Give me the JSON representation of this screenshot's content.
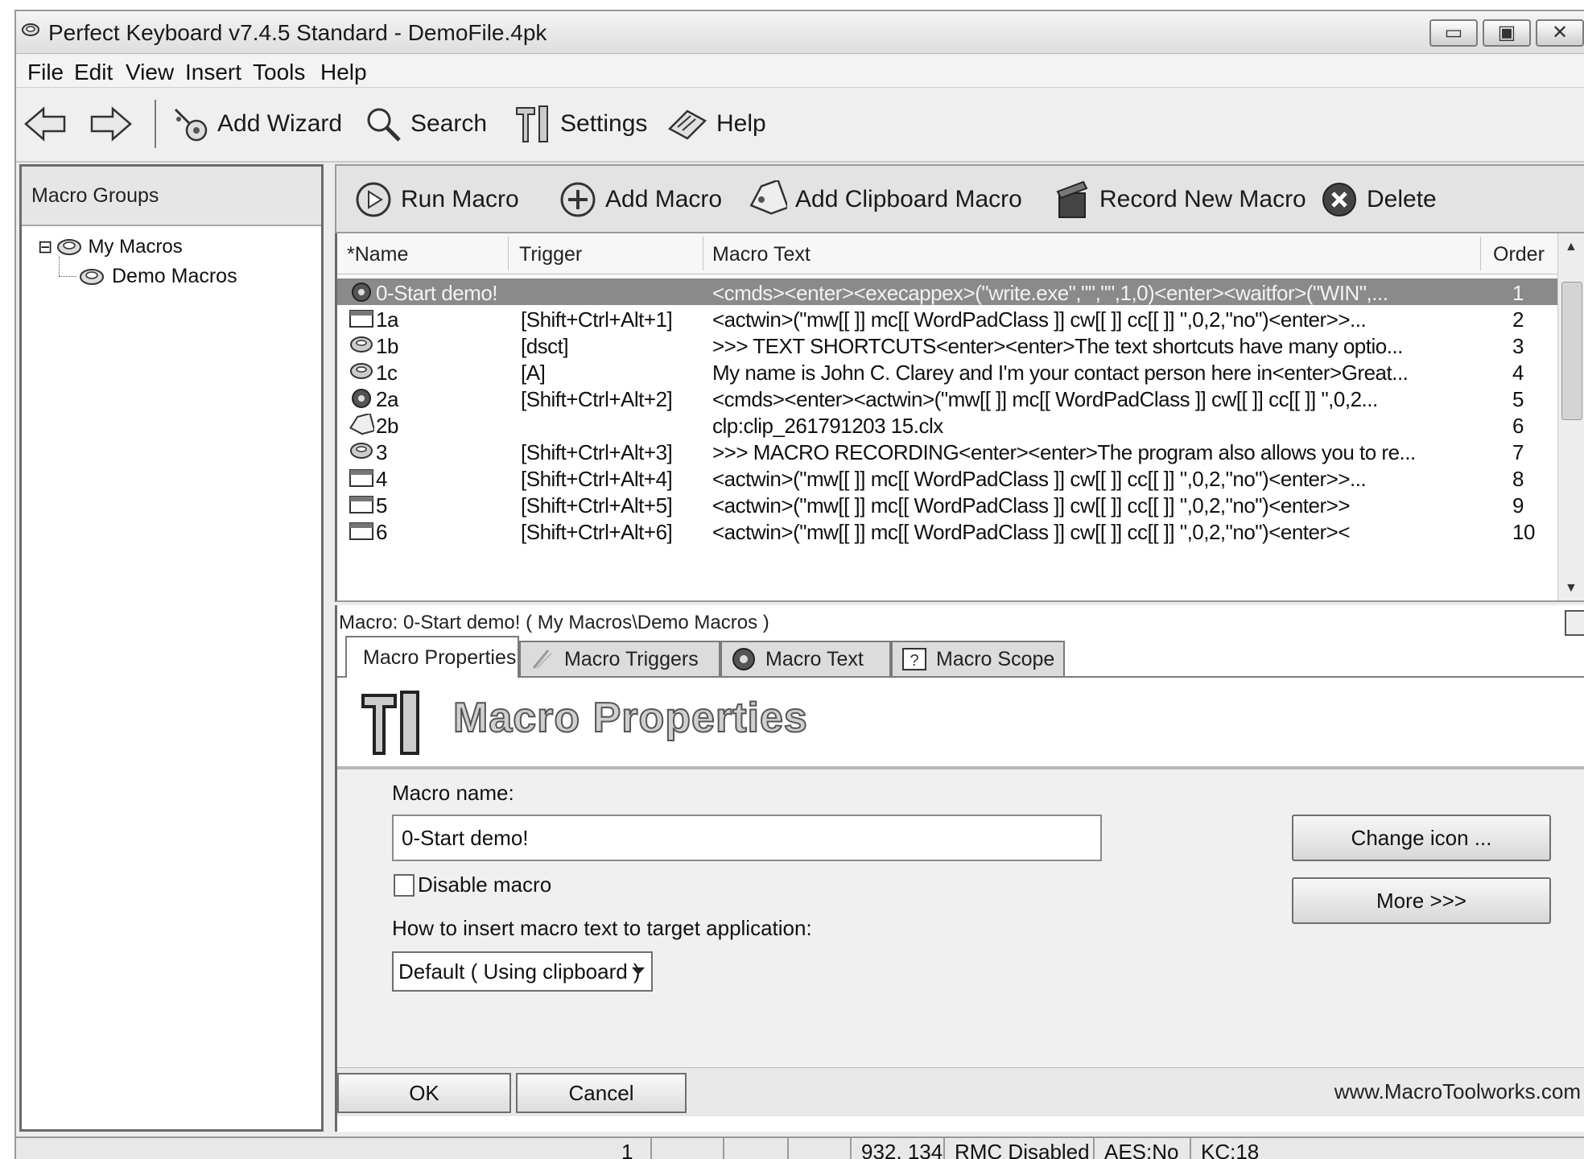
{
  "window": {
    "title": "Perfect Keyboard v7.4.5 Standard - DemoFile.4pk",
    "controls": {
      "minimize": "▭",
      "maximize": "▣",
      "close": "✕"
    }
  },
  "menu": {
    "file": "File",
    "edit": "Edit",
    "view": "View",
    "insert": "Insert",
    "tools": "Tools",
    "help": "Help"
  },
  "toolbar": {
    "add_wizard": "Add Wizard",
    "search": "Search",
    "settings": "Settings",
    "help": "Help"
  },
  "sidebar": {
    "header": "Macro Groups",
    "tree": {
      "root": "My Macros",
      "child": "Demo Macros",
      "expander": "⊟"
    }
  },
  "actions": {
    "run_macro": "Run Macro",
    "add_macro": "Add Macro",
    "add_clipboard_macro": "Add Clipboard Macro",
    "record_new_macro": "Record New Macro",
    "delete": "Delete"
  },
  "grid": {
    "columns": {
      "name": "*Name",
      "trigger": "Trigger",
      "text": "Macro Text",
      "order": "Order"
    },
    "rows": [
      {
        "icon": "gear",
        "name": "0-Start demo!",
        "trigger": "",
        "text": "<cmds><enter><execappex>(\"write.exe\",\"\",\"\",1,0)<enter><waitfor>(\"WIN\",...",
        "order": "1",
        "selected": true
      },
      {
        "icon": "window",
        "name": "1a",
        "trigger": "[Shift+Ctrl+Alt+1]",
        "text": "<actwin>(\"mw[[ ]] mc[[ WordPadClass ]] cw[[ ]] cc[[ ]] \",0,2,\"no\")<enter>>...",
        "order": "2",
        "selected": false
      },
      {
        "icon": "chat",
        "name": "1b",
        "trigger": "[dsct]",
        "text": ">>> TEXT SHORTCUTS<enter><enter>The text shortcuts have many optio...",
        "order": "3",
        "selected": false
      },
      {
        "icon": "chat",
        "name": "1c",
        "trigger": "[A]",
        "text": "My name is John C. Clarey and I'm your contact person here in<enter>Great...",
        "order": "4",
        "selected": false
      },
      {
        "icon": "gear",
        "name": "2a",
        "trigger": "[Shift+Ctrl+Alt+2]",
        "text": "<cmds><enter><actwin>(\"mw[[ ]] mc[[ WordPadClass ]] cw[[ ]] cc[[ ]] \",0,2...",
        "order": "5",
        "selected": false
      },
      {
        "icon": "tag",
        "name": "2b",
        "trigger": "",
        "text": "clp:clip_261791203 15.clx",
        "order": "6",
        "selected": false
      },
      {
        "icon": "chat",
        "name": "3",
        "trigger": "[Shift+Ctrl+Alt+3]",
        "text": ">>> MACRO RECORDING<enter><enter>The program also allows you to re...",
        "order": "7",
        "selected": false
      },
      {
        "icon": "window",
        "name": "4",
        "trigger": "[Shift+Ctrl+Alt+4]",
        "text": "<actwin>(\"mw[[ ]] mc[[ WordPadClass ]] cw[[ ]] cc[[ ]] \",0,2,\"no\")<enter>>...",
        "order": "8",
        "selected": false
      },
      {
        "icon": "window",
        "name": "5",
        "trigger": "[Shift+Ctrl+Alt+5]",
        "text": "<actwin>(\"mw[[ ]] mc[[ WordPadClass ]] cw[[ ]] cc[[ ]] \",0,2,\"no\")<enter>>",
        "order": "9",
        "selected": false
      },
      {
        "icon": "window",
        "name": "6",
        "trigger": "[Shift+Ctrl+Alt+6]",
        "text": "<actwin>(\"mw[[ ]] mc[[ WordPadClass ]] cw[[ ]] cc[[ ]] \",0,2,\"no\")<enter><",
        "order": "10",
        "selected": false
      }
    ]
  },
  "editor": {
    "breadcrumb": "Macro: 0-Start demo! ( My Macros\\Demo Macros )",
    "tabs": {
      "properties": "Macro Properties",
      "triggers": "Macro Triggers",
      "text": "Macro Text",
      "scope": "Macro Scope"
    },
    "banner_title": "Macro Properties",
    "name_label": "Macro name:",
    "name_value": "0-Start demo!",
    "change_icon": "Change icon ...",
    "more": "More >>>",
    "disable_label": "Disable macro",
    "disable_checked": false,
    "insert_label": "How to insert macro text to target application:",
    "insert_mode": "Default ( Using clipboard )",
    "ok": "OK",
    "cancel": "Cancel",
    "url": "www.MacroToolworks.com"
  },
  "status": {
    "seg1": "1",
    "coords": "932, 134",
    "rmc": "RMC Disabled",
    "aes": "AES:No",
    "kc": "KC:18"
  }
}
